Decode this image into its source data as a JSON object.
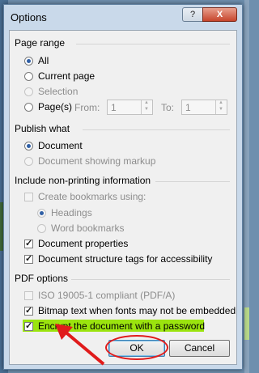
{
  "dialog": {
    "title": "Options",
    "help_label": "?",
    "close_label": "X"
  },
  "page_range": {
    "heading": "Page range",
    "all": "All",
    "current_page": "Current page",
    "selection": "Selection",
    "pages": "Page(s)",
    "from_label": "From:",
    "from_value": "1",
    "to_label": "To:",
    "to_value": "1"
  },
  "publish_what": {
    "heading": "Publish what",
    "document": "Document",
    "document_markup": "Document showing markup"
  },
  "non_printing": {
    "heading": "Include non-printing information",
    "create_bookmarks": "Create bookmarks using:",
    "headings": "Headings",
    "word_bookmarks": "Word bookmarks",
    "document_properties": "Document properties",
    "structure_tags": "Document structure tags for accessibility"
  },
  "pdf_options": {
    "heading": "PDF options",
    "iso": "ISO 19005-1 compliant (PDF/A)",
    "bitmap_text": "Bitmap text when fonts may not be embedded",
    "encrypt": "Encrypt the document with a password"
  },
  "buttons": {
    "ok": "OK",
    "cancel": "Cancel"
  },
  "colors": {
    "highlight": "#9be40e",
    "annotation": "#e01b1b"
  }
}
